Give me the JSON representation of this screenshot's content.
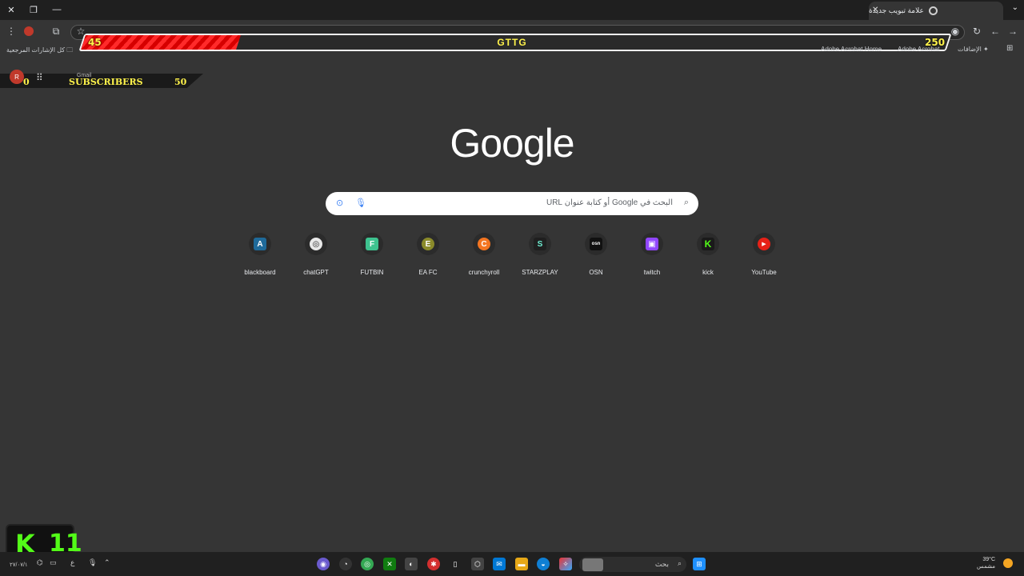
{
  "window": {
    "tab_title": "علامة تبويب جديدة",
    "tab_close": "✕",
    "new_tab": "+",
    "close": "✕",
    "restore": "❐",
    "minimize": "—",
    "tab_search": "⌄"
  },
  "overlay": {
    "left_value": "45",
    "center_title": "GTTG",
    "right_value": "250",
    "progress_fraction": 0.18
  },
  "bookmarks": {
    "all_bookmarks": "كل الإشارات المرجعية",
    "adobe_home": "Adobe Acrobat Home",
    "adobe": "Adobe Acrobat",
    "extensions": "الإضافات"
  },
  "subscribers": {
    "left": "0",
    "label": "SUBSCRIBERS",
    "right": "50",
    "avatar": "R",
    "gmail": "Gmail"
  },
  "logo": "Google",
  "search": {
    "placeholder": "البحث في Google أو كتابة عنوان URL"
  },
  "shortcuts": [
    {
      "label": "blackboard",
      "letter": "A",
      "color": "#1f7a45"
    },
    {
      "label": "chatGPT",
      "letter": "◎",
      "color": "#ffffff"
    },
    {
      "label": "FUTBIN",
      "letter": "F",
      "color": "#3ec28f"
    },
    {
      "label": "EA FC",
      "letter": "E",
      "color": "#7a7a2a"
    },
    {
      "label": "crunchyroll",
      "letter": "C",
      "color": "#f47521"
    },
    {
      "label": "STARZPLAY",
      "letter": "S",
      "color": "#1f1f1f"
    },
    {
      "label": "OSN",
      "letter": "osn",
      "color": "#111111"
    },
    {
      "label": "twitch",
      "letter": "▣",
      "color": "#9146ff"
    },
    {
      "label": "kick",
      "letter": "K",
      "color": "#1a1a1a"
    },
    {
      "label": "YouTube",
      "letter": "▶",
      "color": "#e62117"
    }
  ],
  "kick_widget": {
    "logo": "K",
    "count": "11"
  },
  "taskbar": {
    "search_label": "بحث",
    "temperature": "39°C",
    "weather": "مشمس",
    "lang": "ع",
    "clock": "۲۷/۰۷/۱"
  }
}
